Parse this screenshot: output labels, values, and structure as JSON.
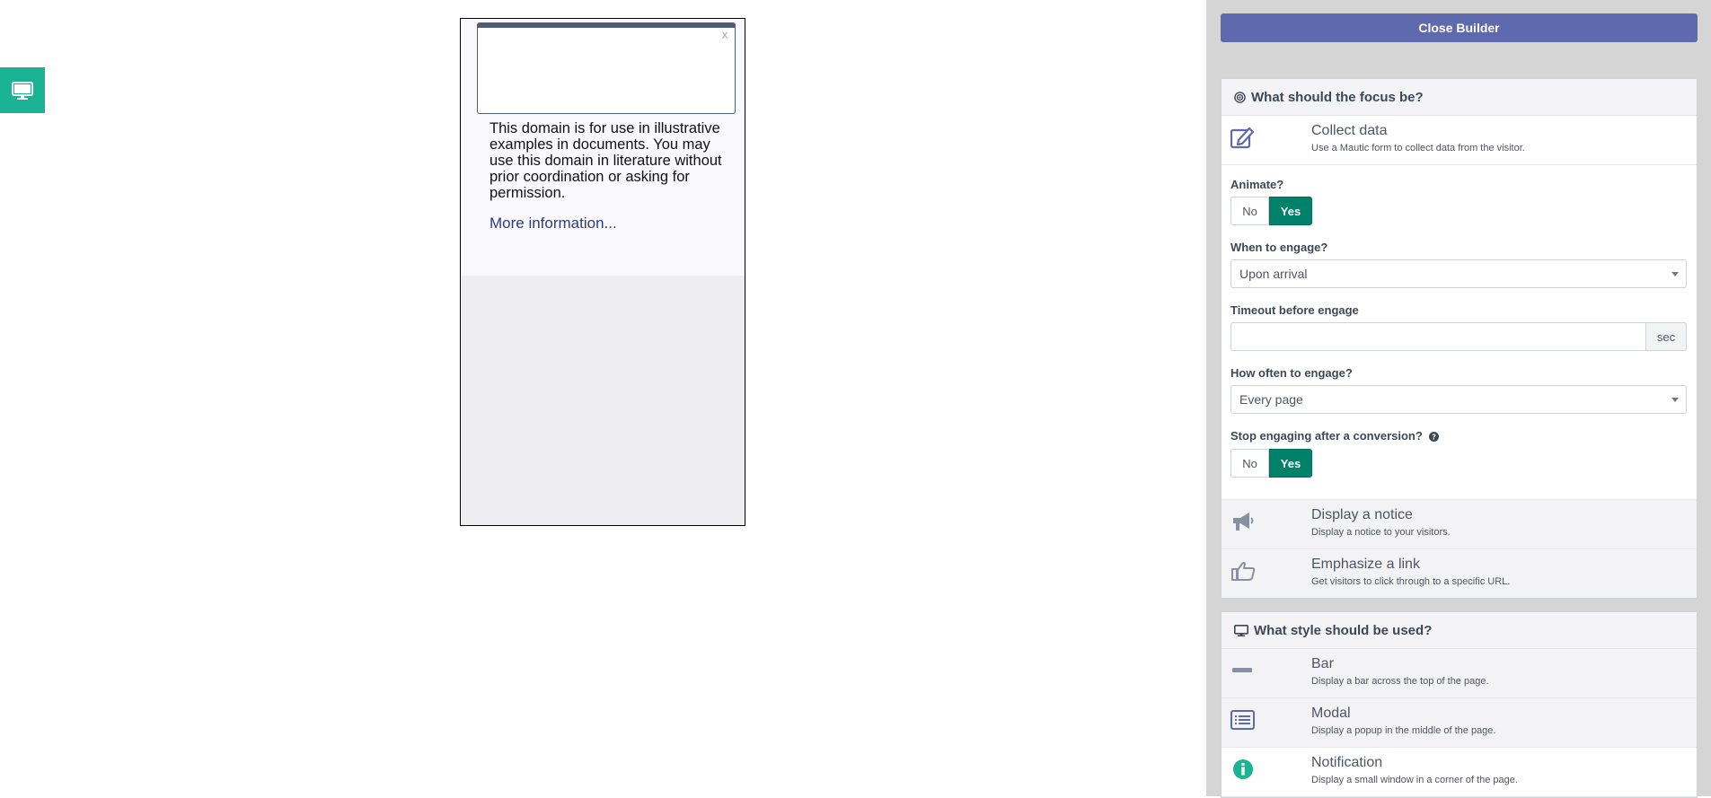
{
  "preview": {
    "close_glyph": "x",
    "paragraph": "This domain is for use in illustrative examples in documents. You may use this domain in literature without prior coordination or asking for permission.",
    "link": "More information..."
  },
  "sidebar": {
    "close_builder": "Close Builder",
    "focus_panel": {
      "title": "What should the focus be?",
      "options": [
        {
          "title": "Collect data",
          "desc": "Use a Mautic form to collect data from the visitor.",
          "icon": "edit-icon"
        },
        {
          "title": "Display a notice",
          "desc": "Display a notice to your visitors.",
          "icon": "megaphone-icon"
        },
        {
          "title": "Emphasize a link",
          "desc": "Get visitors to click through to a specific URL.",
          "icon": "hand-pointer-icon"
        }
      ]
    },
    "fields": {
      "animate_label": "Animate?",
      "no": "No",
      "yes": "Yes",
      "when_label": "When to engage?",
      "when_value": "Upon arrival",
      "timeout_label": "Timeout before engage",
      "timeout_value": "",
      "timeout_unit": "sec",
      "how_often_label": "How often to engage?",
      "how_often_value": "Every page",
      "stop_label": "Stop engaging after a conversion?"
    },
    "style_panel": {
      "title": "What style should be used?",
      "options": [
        {
          "title": "Bar",
          "desc": "Display a bar across the top of the page.",
          "icon": "bar-icon"
        },
        {
          "title": "Modal",
          "desc": "Display a popup in the middle of the page.",
          "icon": "list-alt-icon"
        },
        {
          "title": "Notification",
          "desc": "Display a small window in a corner of the page.",
          "icon": "info-circle-icon"
        }
      ]
    }
  },
  "colors": {
    "accent_teal": "#1ab394",
    "builder_button": "#5e6aad",
    "yes_active": "#00816a"
  }
}
